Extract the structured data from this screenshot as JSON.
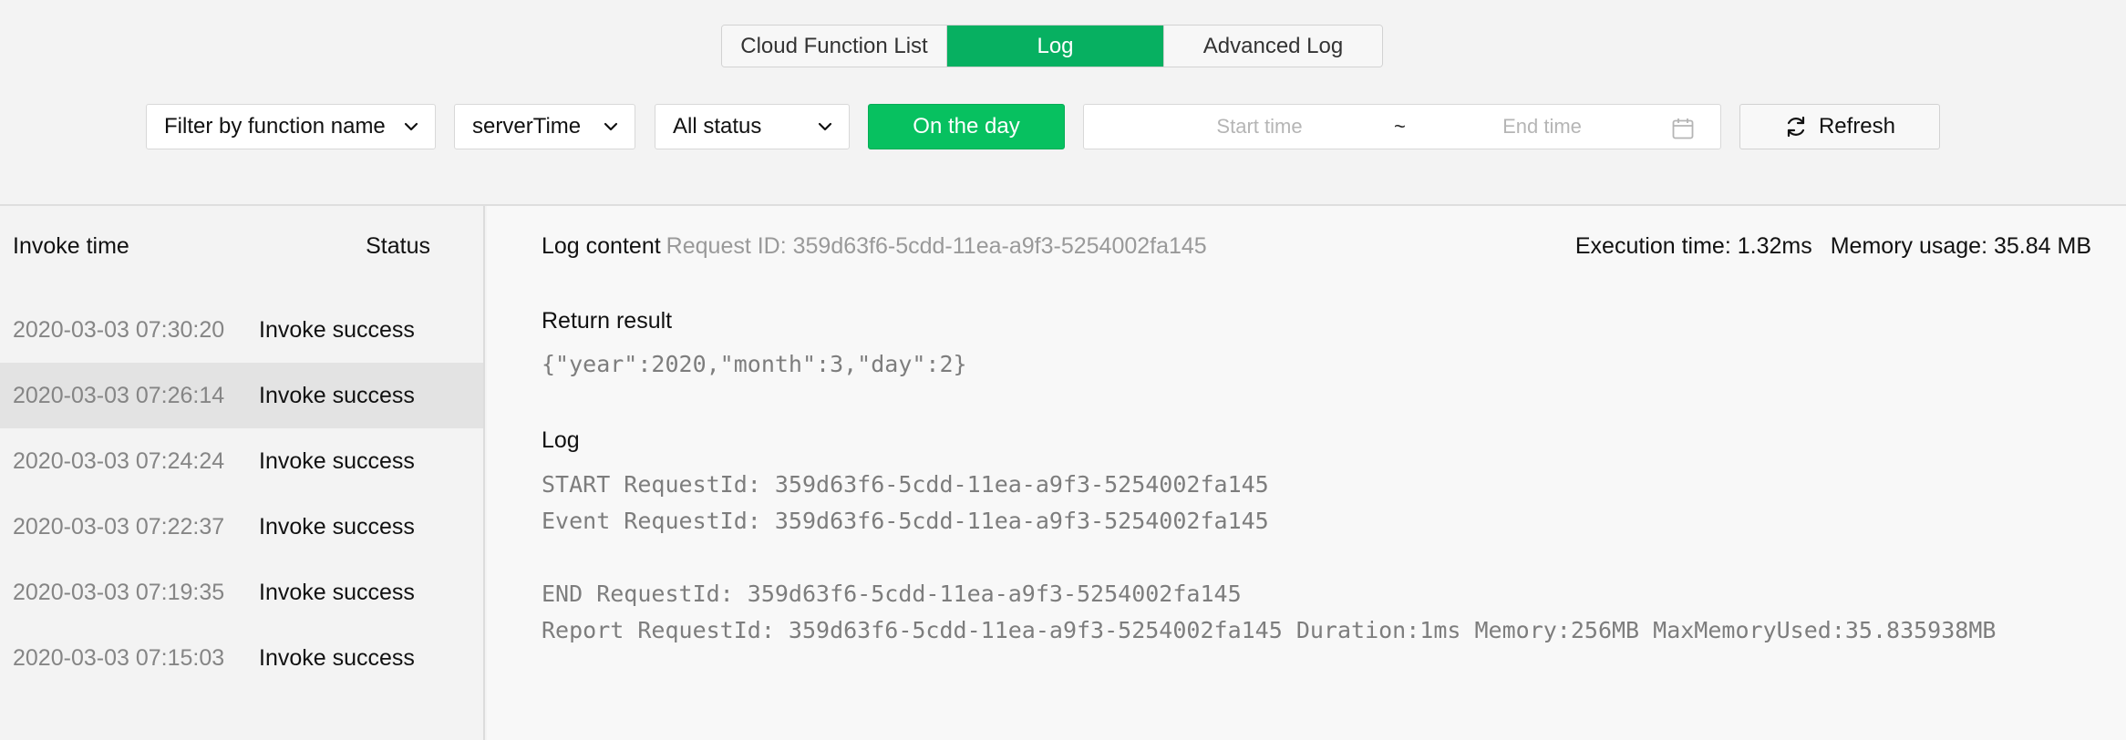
{
  "tabs": [
    {
      "label": "Cloud Function List",
      "active": false
    },
    {
      "label": "Log",
      "active": true
    },
    {
      "label": "Advanced Log",
      "active": false
    }
  ],
  "toolbar": {
    "function_filter": "Filter by function name",
    "function_name": "serverTime",
    "status_filter": "All status",
    "on_the_day_label": "On the day",
    "start_time_placeholder": "Start time",
    "range_separator": "~",
    "end_time_placeholder": "End time",
    "refresh_label": "Refresh"
  },
  "list": {
    "headers": {
      "time": "Invoke time",
      "status": "Status"
    },
    "rows": [
      {
        "time": "2020-03-03 07:30:20",
        "status": "Invoke success"
      },
      {
        "time": "2020-03-03 07:26:14",
        "status": "Invoke success"
      },
      {
        "time": "2020-03-03 07:24:24",
        "status": "Invoke success"
      },
      {
        "time": "2020-03-03 07:22:37",
        "status": "Invoke success"
      },
      {
        "time": "2020-03-03 07:19:35",
        "status": "Invoke success"
      },
      {
        "time": "2020-03-03 07:15:03",
        "status": "Invoke success"
      }
    ],
    "selected_index": 1
  },
  "detail": {
    "log_content_label": "Log content",
    "request_id_text": "Request ID: 359d63f6-5cdd-11ea-a9f3-5254002fa145",
    "execution_time_label": "Execution time:",
    "execution_time_value": "1.32ms",
    "memory_usage_label": "Memory usage:",
    "memory_usage_value": "35.84 MB",
    "return_result_title": "Return result",
    "return_result_value": "{\"year\":2020,\"month\":3,\"day\":2}",
    "log_title": "Log",
    "log_lines": [
      "START RequestId: 359d63f6-5cdd-11ea-a9f3-5254002fa145",
      "Event RequestId: 359d63f6-5cdd-11ea-a9f3-5254002fa145",
      "",
      "END RequestId: 359d63f6-5cdd-11ea-a9f3-5254002fa145",
      "Report RequestId: 359d63f6-5cdd-11ea-a9f3-5254002fa145 Duration:1ms Memory:256MB MaxMemoryUsed:35.835938MB"
    ]
  },
  "colors": {
    "accent": "#07c160",
    "tab_active": "#07b061",
    "background": "#f3f3f3",
    "selected_row": "#e3e3e3"
  },
  "icons": {
    "dropdown": "chevron-down-icon",
    "calendar": "calendar-icon",
    "refresh": "refresh-icon"
  }
}
